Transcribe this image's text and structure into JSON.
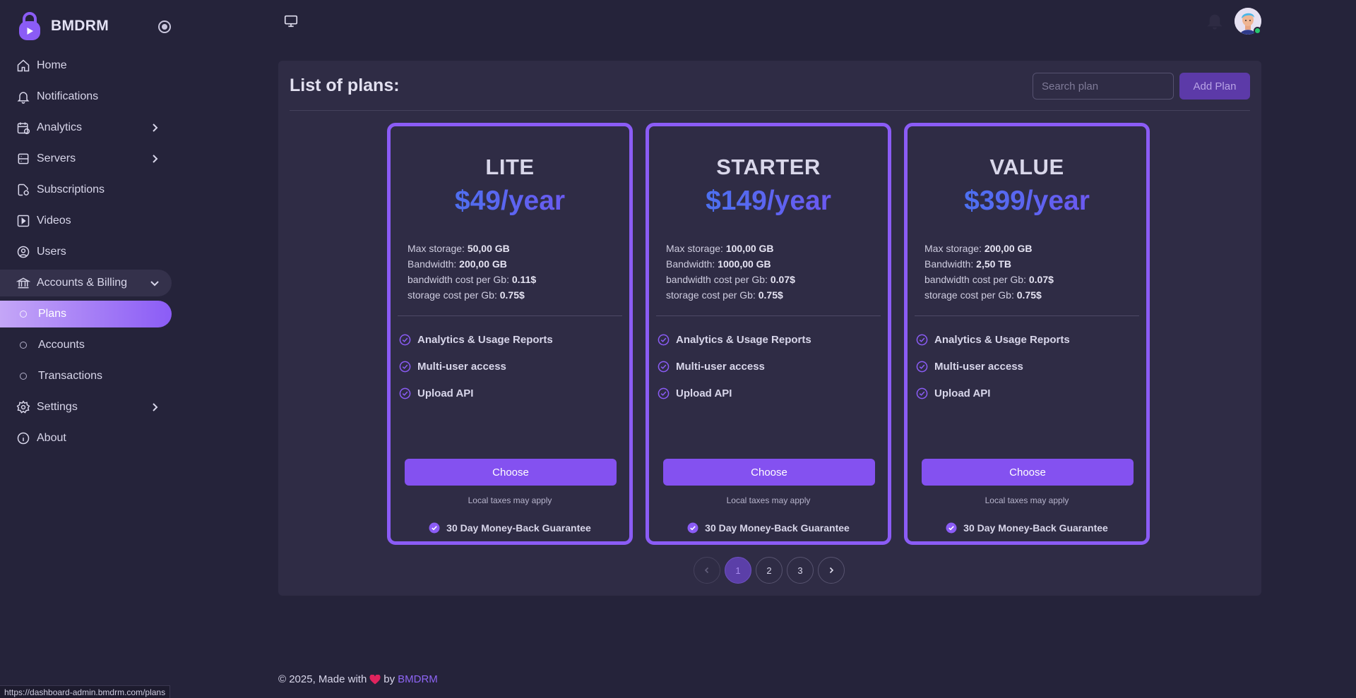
{
  "brand": {
    "name": "BMDRM"
  },
  "sidebar": {
    "items": [
      {
        "label": "Home",
        "icon": "home-icon"
      },
      {
        "label": "Notifications",
        "icon": "bell-icon"
      },
      {
        "label": "Analytics",
        "icon": "calendar-chart-icon",
        "has_arrow": true
      },
      {
        "label": "Servers",
        "icon": "server-icon",
        "has_arrow": true
      },
      {
        "label": "Subscriptions",
        "icon": "file-refresh-icon"
      },
      {
        "label": "Videos",
        "icon": "video-icon"
      },
      {
        "label": "Users",
        "icon": "user-circle-icon"
      },
      {
        "label": "Accounts & Billing",
        "icon": "bank-icon",
        "expanded": true,
        "children": [
          {
            "label": "Plans",
            "active": true
          },
          {
            "label": "Accounts"
          },
          {
            "label": "Transactions"
          }
        ]
      },
      {
        "label": "Settings",
        "icon": "gear-icon",
        "has_arrow": true
      },
      {
        "label": "About",
        "icon": "info-icon"
      }
    ]
  },
  "header": {
    "icons": [
      "monitor-icon",
      "bell-icon"
    ],
    "avatar_status": "online"
  },
  "main": {
    "title": "List of plans:",
    "search": {
      "placeholder": "Search plan",
      "value": ""
    },
    "add_button": "Add Plan"
  },
  "plans": [
    {
      "name": "LITE",
      "price": "$49/year",
      "specs": [
        {
          "label": "Max storage: ",
          "value": "50,00 GB"
        },
        {
          "label": "Bandwidth: ",
          "value": "200,00 GB"
        },
        {
          "label": "bandwidth cost per Gb: ",
          "value": "0.11$"
        },
        {
          "label": "storage cost per Gb: ",
          "value": "0.75$"
        }
      ],
      "features": [
        "Analytics & Usage Reports",
        "Multi-user access",
        "Upload API"
      ],
      "choose": "Choose",
      "taxes": "Local taxes may apply",
      "guarantee": "30 Day Money-Back Guarantee"
    },
    {
      "name": "STARTER",
      "price": "$149/year",
      "specs": [
        {
          "label": "Max storage: ",
          "value": "100,00 GB"
        },
        {
          "label": "Bandwidth: ",
          "value": "1000,00 GB"
        },
        {
          "label": "bandwidth cost per Gb: ",
          "value": "0.07$"
        },
        {
          "label": "storage cost per Gb: ",
          "value": "0.75$"
        }
      ],
      "features": [
        "Analytics & Usage Reports",
        "Multi-user access",
        "Upload API"
      ],
      "choose": "Choose",
      "taxes": "Local taxes may apply",
      "guarantee": "30 Day Money-Back Guarantee"
    },
    {
      "name": "VALUE",
      "price": "$399/year",
      "specs": [
        {
          "label": "Max storage: ",
          "value": "200,00 GB"
        },
        {
          "label": "Bandwidth: ",
          "value": "2,50 TB"
        },
        {
          "label": "bandwidth cost per Gb: ",
          "value": "0.07$"
        },
        {
          "label": "storage cost per Gb: ",
          "value": "0.75$"
        }
      ],
      "features": [
        "Analytics & Usage Reports",
        "Multi-user access",
        "Upload API"
      ],
      "choose": "Choose",
      "taxes": "Local taxes may apply",
      "guarantee": "30 Day Money-Back Guarantee"
    }
  ],
  "pagination": {
    "pages": [
      "1",
      "2",
      "3"
    ],
    "current": "1"
  },
  "footer": {
    "text": "© 2025, Made with",
    "by": "by",
    "brand": "BMDRM"
  },
  "status_url": "https://dashboard-admin.bmdrm.com/plans",
  "colors": {
    "accent": "#8b5cf6",
    "background": "#25233a",
    "card": "#2f2c45",
    "online": "#28c76f"
  }
}
